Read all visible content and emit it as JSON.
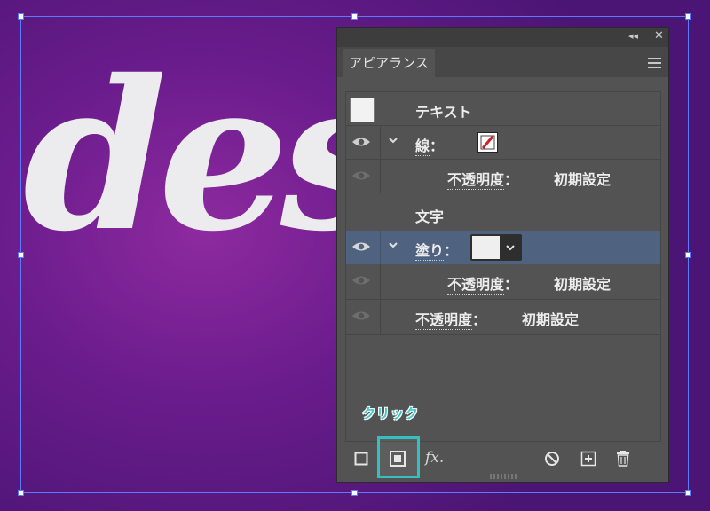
{
  "artwork": {
    "text": "des"
  },
  "panel": {
    "tab_label": "アピアランス",
    "rows": {
      "object_type": "テキスト",
      "stroke_label": "線",
      "stroke_colon": "：",
      "opacity_label": "不透明度",
      "opacity_colon": "：",
      "opacity_value": "初期設定",
      "characters": "文字",
      "fill_label": "塗り",
      "fill_colon": "：",
      "fill_opacity_label": "不透明度",
      "fill_opacity_colon": "：",
      "fill_opacity_value": "初期設定",
      "text_opacity_label": "不透明度",
      "text_opacity_colon": "：",
      "text_opacity_value": "初期設定"
    },
    "footer": {
      "fx_label": "fx."
    }
  },
  "callout": {
    "label": "クリック"
  },
  "colors": {
    "panel_bg": "#535353",
    "highlight_row": "#4f6380",
    "callout": "#35bfbf",
    "selection": "#5b7bff",
    "stroke_slash": "#d0202a"
  }
}
